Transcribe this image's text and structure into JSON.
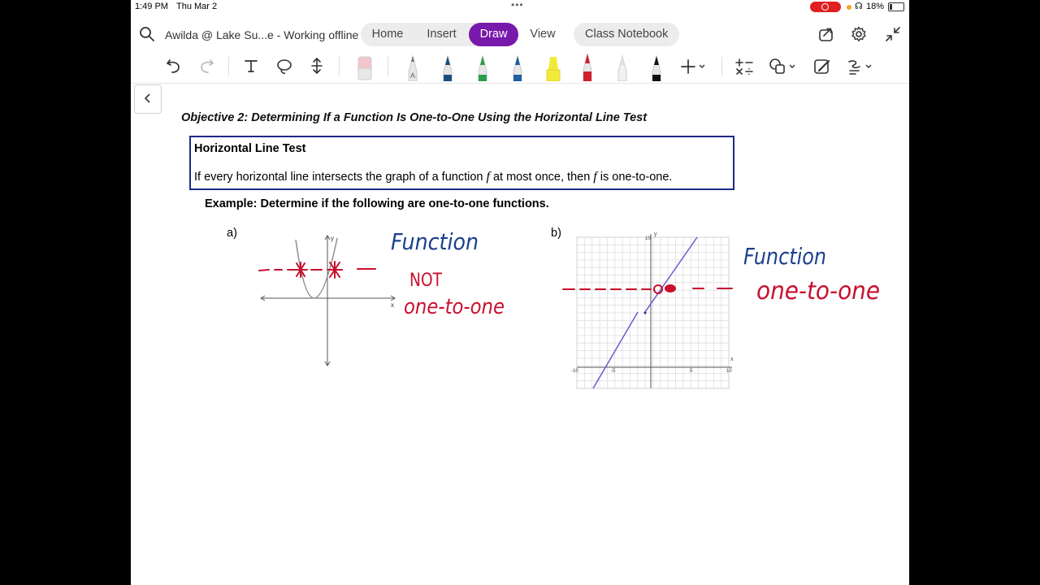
{
  "status_bar": {
    "time": "1:49 PM",
    "date": "Thu Mar 2",
    "battery": "18%"
  },
  "top_bar": {
    "document_title": "Awilda @ Lake Su...e - Working offline",
    "tabs": [
      {
        "label": "Home",
        "active": false
      },
      {
        "label": "Insert",
        "active": false
      },
      {
        "label": "Draw",
        "active": true
      },
      {
        "label": "View",
        "active": false
      }
    ],
    "class_notebook": "Class Notebook",
    "accent_color": "#7719aa"
  },
  "toolbar": {
    "tools": [
      "undo-icon",
      "redo-icon",
      "type-icon",
      "lasso-icon",
      "insert-space-icon",
      "eraser-icon",
      "pencil-icon",
      "pen-blue-icon",
      "pen-green-icon",
      "pen-dark-blue-icon",
      "highlighter-yellow-icon",
      "pen-red-icon",
      "pen-white-icon",
      "pen-black-icon",
      "add-pen-icon",
      "ink-to-math-icon",
      "shapes-icon",
      "ink-to-shape-icon",
      "replay-icon"
    ],
    "pen_colors": [
      "#1d4e79",
      "#2a9d4a",
      "#1d5fa0",
      "#f2ea3a",
      "#d0202e",
      "#e8e8e8",
      "#111111"
    ]
  },
  "page": {
    "objective": "Objective 2: Determining If a Function Is One-to-One Using the Horizontal Line Test",
    "box_heading": "Horizontal Line Test",
    "box_body_1": "If every horizontal line intersects the graph of a function ",
    "box_var_1": "f",
    "box_body_2": " at most once, then ",
    "box_var_2": "f",
    "box_body_3": " is one-to-one.",
    "example": "Example: Determine if the following are one-to-one functions.",
    "part_a": "a)",
    "part_b": "b)",
    "graph_b_ticks": {
      "x": [
        "-10",
        "-5",
        "5",
        "10"
      ],
      "y": [
        "10"
      ]
    },
    "axis_x": "x",
    "axis_y": "y",
    "ink_blue_a": "Function",
    "ink_red_a_1": "NOT",
    "ink_red_a_2": "one-to-one",
    "ink_blue_b": "Function",
    "ink_red_b": "one-to-one",
    "ink_blue_color": "#1b3f8f",
    "ink_red_color": "#c8102e"
  }
}
